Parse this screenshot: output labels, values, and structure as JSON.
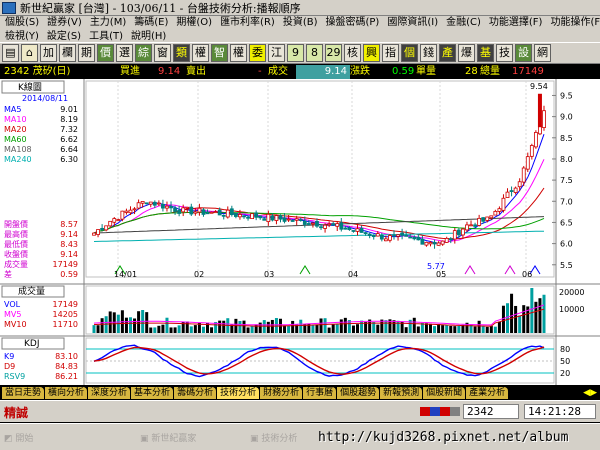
{
  "window": {
    "title": "新世紀贏家 [台灣] - 103/06/11 - 台盤技術分析:播報順序"
  },
  "menu": {
    "row1": [
      "個股(S)",
      "證券(V)",
      "主力(M)",
      "籌碼(E)",
      "期權(O)",
      "匯市利率(R)",
      "投資(B)",
      "操盤密碼(P)",
      "國際資訊(I)",
      "金融(C)",
      "功能選擇(F)",
      "功能操作(F)"
    ],
    "row2": [
      "檢視(Y)",
      "設定(S)",
      "工具(T)",
      "說明(H)"
    ]
  },
  "toolbar": {
    "buttons": [
      {
        "label": "",
        "icon": "book-icon"
      },
      {
        "label": "",
        "icon": "home-icon"
      },
      {
        "label": "加"
      },
      {
        "label": "欄"
      },
      {
        "label": "期"
      },
      {
        "label": "價"
      },
      {
        "label": "選"
      },
      {
        "label": "綜"
      },
      {
        "label": "窗"
      },
      {
        "label": "類"
      },
      {
        "label": "權"
      },
      {
        "label": "智"
      },
      {
        "label": "權"
      },
      {
        "label": "委"
      },
      {
        "label": "江"
      },
      {
        "label": "9"
      },
      {
        "label": "8"
      },
      {
        "label": "29"
      },
      {
        "label": "核"
      },
      {
        "label": "興"
      },
      {
        "label": "指"
      },
      {
        "label": "個"
      },
      {
        "label": "錢"
      },
      {
        "label": "產"
      },
      {
        "label": "爆"
      },
      {
        "label": "基"
      },
      {
        "label": "技"
      },
      {
        "label": "設"
      },
      {
        "label": "網"
      }
    ]
  },
  "quote": {
    "stock": "2342 茂矽(日)",
    "buy_label": "買進",
    "buy": "9.14",
    "sell_label": "賣出",
    "sell": "-",
    "last_label": "成交",
    "last": "9.14",
    "change_label": "漲跌",
    "change": "0.59",
    "vol_label": "單量",
    "vol": "28",
    "total_label": "總量",
    "total": "17149"
  },
  "kline_panel": {
    "header": "K線圖",
    "date": "2014/08/11",
    "ma": [
      {
        "name": "MA5",
        "value": "9.01",
        "color": "#0000ff"
      },
      {
        "name": "MA10",
        "value": "8.19",
        "color": "#ff00ff"
      },
      {
        "name": "MA20",
        "value": "7.32",
        "color": "#d00000"
      },
      {
        "name": "MA60",
        "value": "6.62",
        "color": "#00a000"
      },
      {
        "name": "MA108",
        "value": "6.64",
        "color": "#606060"
      },
      {
        "name": "MA240",
        "value": "6.30",
        "color": "#00b0b0"
      }
    ],
    "ohlc": [
      {
        "name": "開盤價",
        "value": "8.57"
      },
      {
        "name": "最高價",
        "value": "9.14"
      },
      {
        "name": "最低價",
        "value": "8.43"
      },
      {
        "name": "收盤價",
        "value": "9.14"
      },
      {
        "name": "成交量",
        "value": "17149"
      },
      {
        "name": "差",
        "value": "0.59"
      }
    ],
    "y_ticks": [
      "9.5",
      "9.0",
      "8.5",
      "8.0",
      "7.5",
      "7.0",
      "6.5",
      "6.0",
      "5.5"
    ],
    "x_ticks": [
      "14/01",
      "02",
      "03",
      "04",
      "05",
      "06"
    ],
    "high_mark": "9.54",
    "low_mark": "5.77"
  },
  "volume_panel": {
    "header": "成交量",
    "items": [
      {
        "name": "VOL",
        "value": "17149",
        "color": "#0000ff"
      },
      {
        "name": "MV5",
        "value": "14205",
        "color": "#ff00ff"
      },
      {
        "name": "MV10",
        "value": "11710",
        "color": "#d00000"
      }
    ],
    "y_ticks": [
      "20000",
      "10000"
    ]
  },
  "kd_panel": {
    "header": "KDJ",
    "items": [
      {
        "name": "K9",
        "value": "83.10",
        "color": "#0000ff"
      },
      {
        "name": "D9",
        "value": "84.83",
        "color": "#d00000"
      },
      {
        "name": "RSV9",
        "value": "86.21",
        "color": "#00a0a0"
      }
    ],
    "y_ticks": [
      "80",
      "50",
      "20"
    ]
  },
  "tabs": [
    "當日走勢",
    "橫向分析",
    "深度分析",
    "基本分析",
    "籌碼分析",
    "技術分析",
    "財務分析",
    "行事曆",
    "個股趨勢",
    "新報預測",
    "個股新聞",
    "產業分析"
  ],
  "active_tab": 5,
  "status": {
    "left_label": "精誠",
    "code": "2342",
    "time": "14:21:28"
  },
  "taskbar": {
    "url": "http://kujd3268.pixnet.net/album"
  },
  "chart_data": {
    "type": "candlestick",
    "price_range": [
      5.4,
      9.7
    ],
    "x_months": [
      "14/01",
      "02",
      "03",
      "04",
      "05",
      "06"
    ],
    "last_close": 9.14,
    "high": 9.54,
    "low": 5.77
  },
  "colors": {
    "up": "#d00000",
    "down": "#008080",
    "bg": "#ffffff",
    "panel_text": "#0000ff"
  }
}
